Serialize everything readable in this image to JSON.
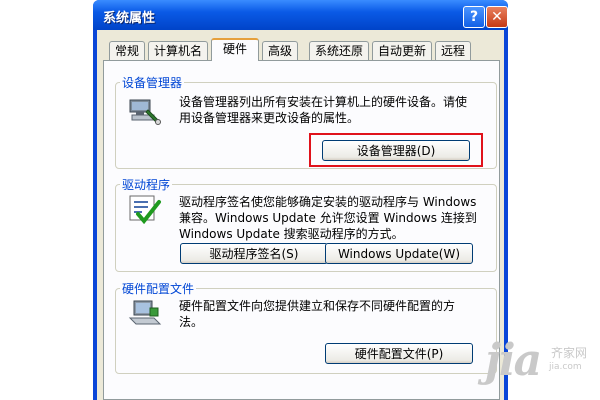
{
  "window": {
    "title": "系统属性",
    "help_label": "?",
    "close_label": "✕"
  },
  "tabs": [
    {
      "label": "常规"
    },
    {
      "label": "计算机名"
    },
    {
      "label": "硬件",
      "active": true
    },
    {
      "label": "高级"
    },
    {
      "label": "系统还原"
    },
    {
      "label": "自动更新"
    },
    {
      "label": "远程"
    }
  ],
  "device_manager": {
    "title": "设备管理器",
    "desc_line1": "设备管理器列出所有安装在计算机上的硬件设备。请使",
    "desc_line2": "用设备管理器来更改设备的属性。",
    "button_label": "设备管理器(D)",
    "icon": "device-manager-icon",
    "highlight_color": "#e0121b"
  },
  "drivers": {
    "title": "驱动程序",
    "desc_line1": "驱动程序签名使您能够确定安装的驱动程序与 Windows",
    "desc_line2": "兼容。Windows Update 允许您设置 Windows 连接到",
    "desc_line3": "Windows Update 搜索驱动程序的方式。",
    "signing_button": "驱动程序签名(S)",
    "update_button": "Windows Update(W)",
    "icon": "driver-checklist-icon"
  },
  "hardware_profiles": {
    "title": "硬件配置文件",
    "desc_line1": "硬件配置文件向您提供建立和保存不同硬件配置的方",
    "desc_line2": "法。",
    "button_label": "硬件配置文件(P)",
    "icon": "hardware-profile-icon"
  },
  "watermark": {
    "logo": "jia",
    "cn": "齐家网",
    "url": "jia.com"
  }
}
